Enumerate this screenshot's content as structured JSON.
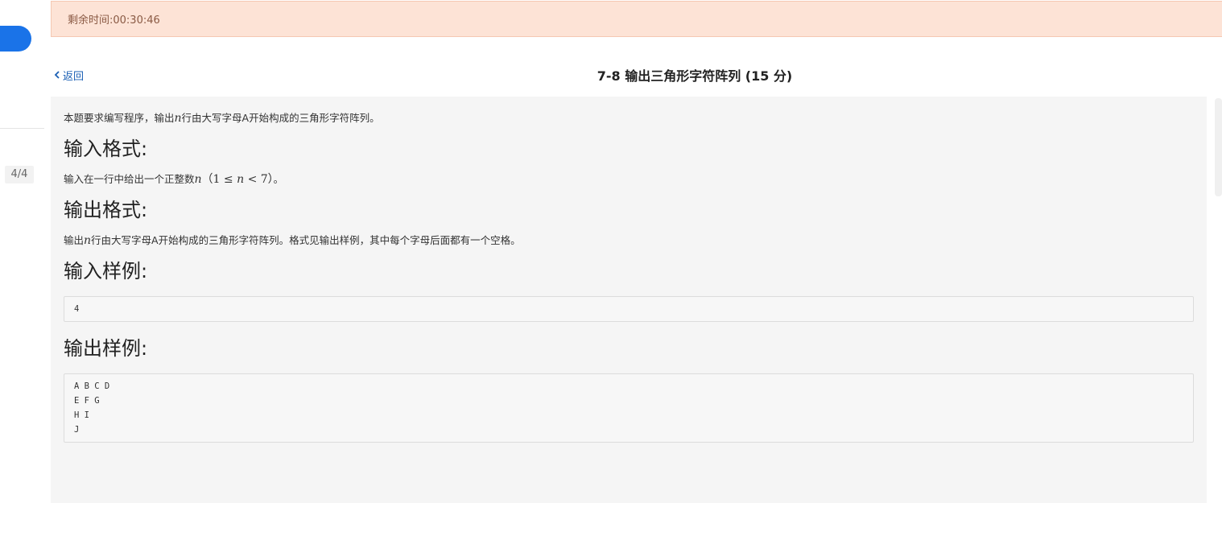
{
  "sidebar": {
    "counter": "4/4"
  },
  "timer": {
    "text": "剩余时间:00:30:46"
  },
  "header": {
    "back_label": "返回",
    "title": "7-8 输出三角形字符阵列 (15 分)"
  },
  "problem": {
    "intro_before": "本题要求编写程序，输出",
    "intro_var": "n",
    "intro_after": "行由大写字母A开始构成的三角形字符阵列。",
    "input_format_heading": "输入格式:",
    "input_format_before": "输入在一行中给出一个正整数",
    "input_format_var": "n",
    "input_format_range_open": "（1 ≤ ",
    "input_format_range_var": "n",
    "input_format_range_close": " < 7）",
    "input_format_after": "。",
    "output_format_heading": "输出格式:",
    "output_format_before": "输出",
    "output_format_var": "n",
    "output_format_after": "行由大写字母A开始构成的三角形字符阵列。格式见输出样例，其中每个字母后面都有一个空格。",
    "input_sample_heading": "输入样例:",
    "input_sample_lines": [
      "4"
    ],
    "output_sample_heading": "输出样例:",
    "output_sample_lines": [
      "A B C D",
      "E F G",
      "H I",
      "J"
    ]
  },
  "colors": {
    "accent": "#1a73e8",
    "banner_bg": "#fde3d6",
    "link": "#1a5fb4",
    "panel_bg": "#f5f5f5"
  }
}
